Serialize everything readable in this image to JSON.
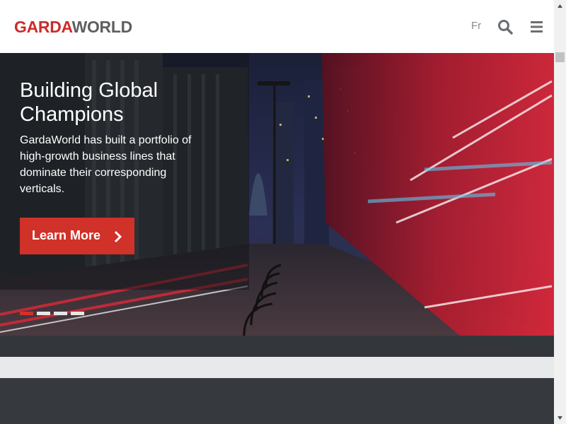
{
  "header": {
    "logo": {
      "part1": "GARDA",
      "part2": "WORLD"
    },
    "language_toggle": "Fr",
    "search_icon": "search-icon",
    "menu_icon": "hamburger-menu-icon"
  },
  "hero": {
    "title": "Building Global Champions",
    "description": "GardaWorld has built a portfolio of high-growth business lines that dominate their corresponding verticals.",
    "cta_label": "Learn More",
    "cta_icon": "chevron-right-icon",
    "slides": {
      "count": 4,
      "active": 1
    }
  },
  "colors": {
    "brand_red": "#d03129",
    "logo_gray": "#5d5f61",
    "dark_band": "#33363b",
    "light_band": "#e8e9ea"
  }
}
